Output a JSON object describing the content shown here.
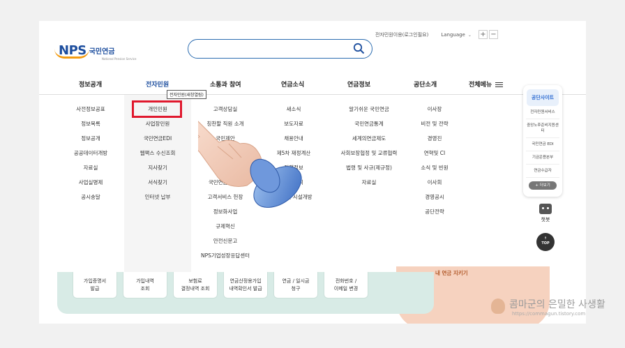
{
  "header": {
    "logo_mark": "NPS",
    "logo_kr": "국민연금",
    "logo_sub": "National Pension Service",
    "util_text": "전자민원이용(로그인필요)",
    "language_label": "Language",
    "zoom_in": "+",
    "zoom_out": "−"
  },
  "search": {
    "placeholder": ""
  },
  "gnb": [
    "정보공개",
    "전자민원",
    "소통과 참여",
    "연금소식",
    "연금정보",
    "공단소개",
    "전체메뉴"
  ],
  "tooltip": "전자민원(새창열림)",
  "menu": {
    "col1": [
      "사전정보공표",
      "정보목록",
      "정보공개",
      "공공데이터개방",
      "자료실",
      "사업실명제",
      "공시송달"
    ],
    "col2": [
      "개인민원",
      "사업장민원",
      "국민연금EDI",
      "웹팩스 수신조회",
      "지사찾기",
      "서식찾기",
      "인터넷 납부"
    ],
    "col3": [
      "고객상담실",
      "칭찬할 직원 소개",
      "국민제안",
      "",
      "",
      "국민연금자문단",
      "고객서비스 헌장",
      "정보화사업",
      "규제혁신",
      "안전신문고",
      "NPS기업성장응답센터"
    ],
    "col4": [
      "새소식",
      "보도자료",
      "채용안내",
      "제5차 재정계산",
      "정책정보",
      "센터소식",
      "임대 및 시설개방"
    ],
    "col5": [
      "알기쉬운 국민연금",
      "국민연금통계",
      "세계의연금제도",
      "사회보장협정 및 교류협력",
      "법령 및 사규(제규정)",
      "자료실"
    ],
    "col6": [
      "이사장",
      "비전 및 전략",
      "경영진",
      "연혁및 CI",
      "소식 및 빈원",
      "이사회",
      "경영공시",
      "공단전략"
    ]
  },
  "site": {
    "title": "공단사이트",
    "items": [
      "전자민원서비스",
      "중앙노후준비지원센터",
      "국민연금 EDI",
      "기금운용본부",
      "연금수급자"
    ],
    "more": "+ 더보기"
  },
  "chatbot_label": "챗봇",
  "top_label": "TOP",
  "quick": [
    [
      "가입증명서",
      "발급"
    ],
    [
      "가입내역",
      "조회"
    ],
    [
      "보험료",
      "결정내역 조회"
    ],
    [
      "연금산정용가입",
      "내역확인서 발급"
    ],
    [
      "연금 / 일시금",
      "청구"
    ],
    [
      "전화번호 /",
      "이메일 변경"
    ]
  ],
  "banner_text": "내 연금 지키기",
  "watermark": {
    "title": "콤마군의 은밀한 사생활",
    "url": "https://commagun.tistory.com"
  },
  "colors": {
    "brand": "#1d4e9e",
    "highlight": "#e0182d",
    "panel": "#d8ebe6"
  }
}
